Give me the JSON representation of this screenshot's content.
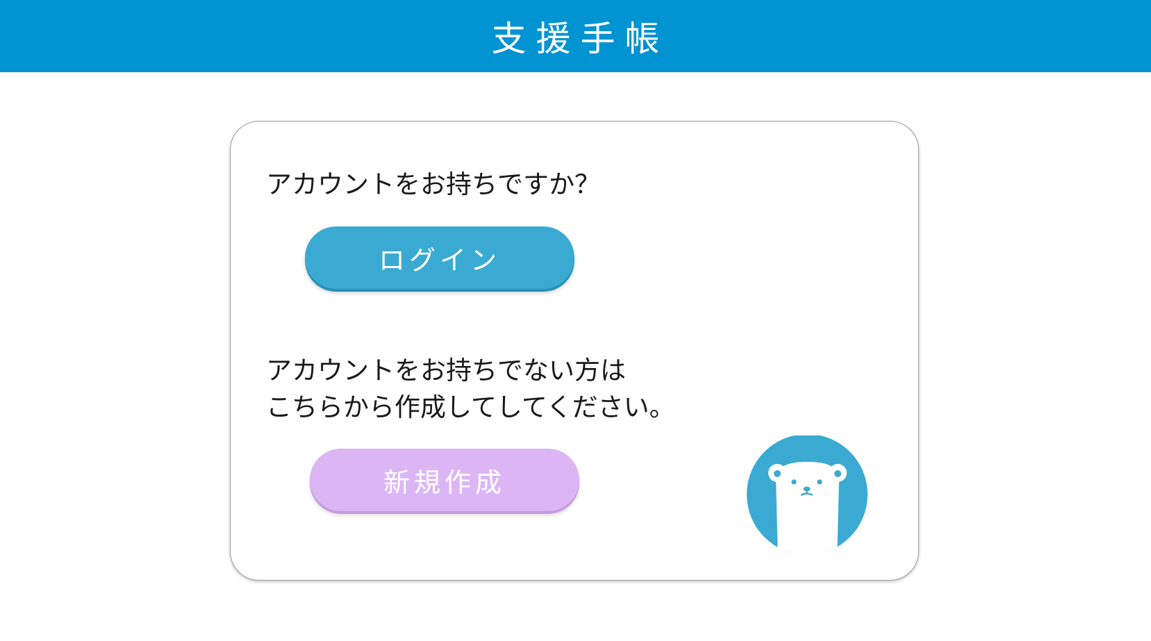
{
  "app": {
    "title": "支援手帳"
  },
  "login_section": {
    "prompt": "アカウントをお持ちですか？",
    "button_label": "ログイン"
  },
  "signup_section": {
    "prompt_lines": [
      "アカウントをお持ちでない方は",
      "こちらから作成してしてください。"
    ],
    "button_label": "新規作成"
  },
  "mascot": {
    "icon": "polar-bear-icon"
  },
  "colors": {
    "header": "#0293d2",
    "login_button": "#3aaad3",
    "signup_button": "#dcb6f4",
    "mascot_circle": "#3aaad3"
  }
}
